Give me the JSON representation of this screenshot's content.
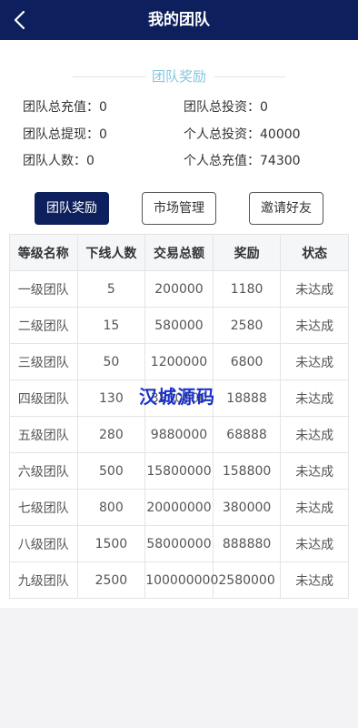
{
  "header": {
    "title": "我的团队",
    "back_icon": "chevron-left-icon"
  },
  "section_title": "团队奖励",
  "stats": [
    {
      "label": "团队总充值：",
      "value": "0"
    },
    {
      "label": "团队总投资：",
      "value": "0"
    },
    {
      "label": "团队总提现：",
      "value": "0"
    },
    {
      "label": "个人总投资：",
      "value": "40000"
    },
    {
      "label": "团队人数：",
      "value": "0"
    },
    {
      "label": "个人总充值：",
      "value": "74300"
    }
  ],
  "buttons": [
    "团队奖励",
    "市场管理",
    "邀请好友"
  ],
  "table": {
    "headers": [
      "等级名称",
      "下线人数",
      "交易总额",
      "奖励",
      "状态"
    ],
    "rows": [
      [
        "一级团队",
        "5",
        "200000",
        "1180",
        "未达成"
      ],
      [
        "二级团队",
        "15",
        "580000",
        "2580",
        "未达成"
      ],
      [
        "三级团队",
        "50",
        "1200000",
        "6800",
        "未达成"
      ],
      [
        "四级团队",
        "130",
        "3800000",
        "18888",
        "未达成"
      ],
      [
        "五级团队",
        "280",
        "9880000",
        "68888",
        "未达成"
      ],
      [
        "六级团队",
        "500",
        "15800000",
        "158800",
        "未达成"
      ],
      [
        "七级团队",
        "800",
        "20000000",
        "380000",
        "未达成"
      ],
      [
        "八级团队",
        "1500",
        "58000000",
        "888880",
        "未达成"
      ],
      [
        "九级团队",
        "2500",
        "100000000",
        "2580000",
        "未达成"
      ]
    ]
  },
  "watermark": "汉城源码",
  "colors": {
    "header_bg": "#0d1f5c",
    "section_title": "#86c6dc",
    "watermark": "#1b32c8"
  }
}
